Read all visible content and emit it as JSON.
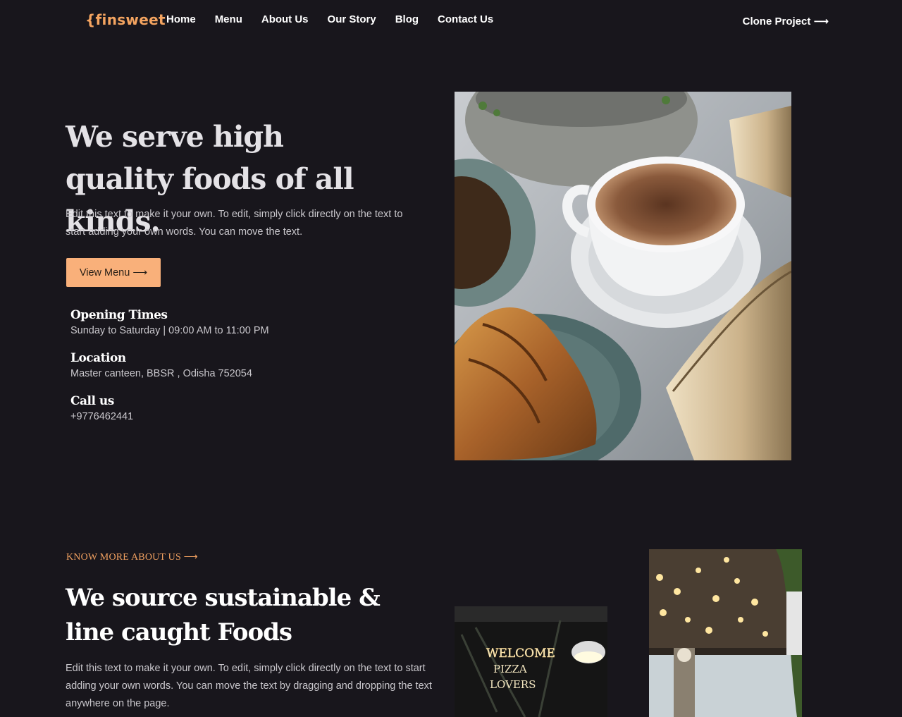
{
  "nav": {
    "logo": "{finsweet",
    "links": [
      "Home",
      "Menu",
      "About Us",
      "Our Story",
      "Blog",
      "Contact Us"
    ],
    "cta": "Clone Project ⟶"
  },
  "hero": {
    "title": "We serve high quality foods of all kinds.",
    "text": "Edit this text to make it your own. To edit, simply click directly on the text to start adding your own words. You can move the text.",
    "button": "View Menu ⟶"
  },
  "info": [
    {
      "heading": "Opening Times",
      "value": "Sunday to Saturday | 09:00 AM to 11:00 PM"
    },
    {
      "heading": "Location",
      "value": "Master canteen, BBSR , Odisha 752054"
    },
    {
      "heading": "Call us",
      "value": "+9776462441"
    }
  ],
  "about": {
    "eyebrow": "KNOW MORE ABOUT US ⟶",
    "title": "We source sustainable & line caught Foods",
    "text": "Edit this text to make it your own. To edit, simply click directly on the text to start adding your own words. You can move the text by dragging and dropping the text anywhere on the page."
  },
  "colors": {
    "background": "#18161c",
    "accent": "#f9b07a",
    "accent_text": "#f0a060"
  }
}
